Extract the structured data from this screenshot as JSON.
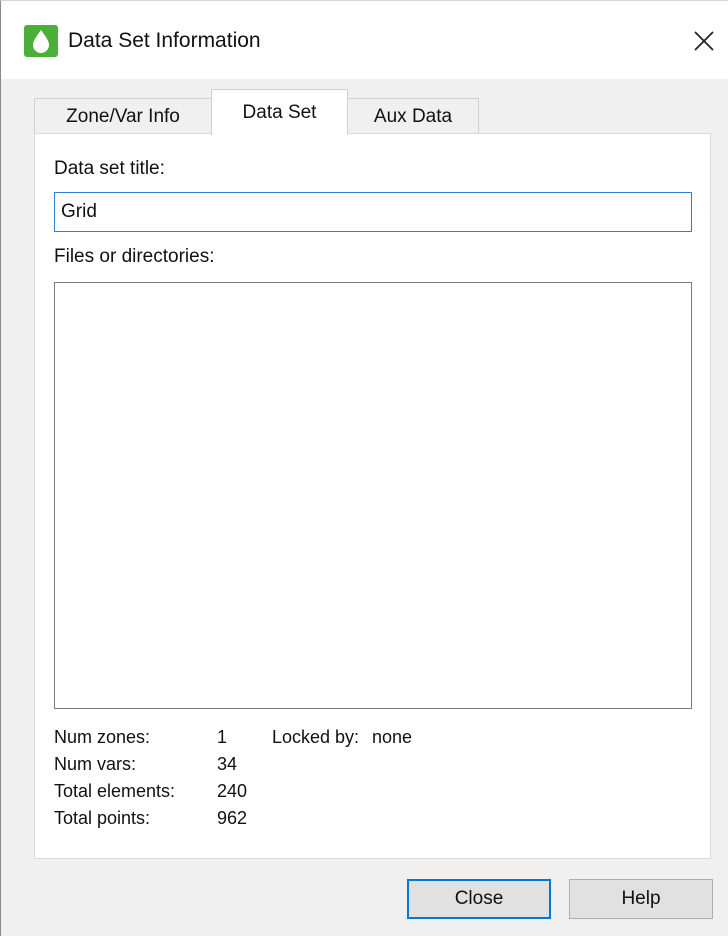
{
  "window": {
    "title": "Data Set Information"
  },
  "tabs": [
    {
      "label": "Zone/Var Info",
      "active": false
    },
    {
      "label": "Data Set",
      "active": true
    },
    {
      "label": "Aux Data",
      "active": false
    }
  ],
  "data_set": {
    "title_label": "Data set title:",
    "title_value": "Grid",
    "files_label": "Files or directories:",
    "files": []
  },
  "stats": {
    "num_zones_label": "Num zones:",
    "num_zones": "1",
    "locked_by_label": "Locked by:",
    "locked_by": "none",
    "num_vars_label": "Num vars:",
    "num_vars": "34",
    "total_elements_label": "Total elements:",
    "total_elements": "240",
    "total_points_label": "Total points:",
    "total_points": "962"
  },
  "buttons": {
    "close": "Close",
    "help": "Help"
  },
  "icons": {
    "app": "droplet-icon",
    "close": "close-icon"
  },
  "colors": {
    "app_icon_bg": "#4caf3a",
    "focus_border": "#2b7fd4",
    "default_button_border": "#0078d7"
  }
}
